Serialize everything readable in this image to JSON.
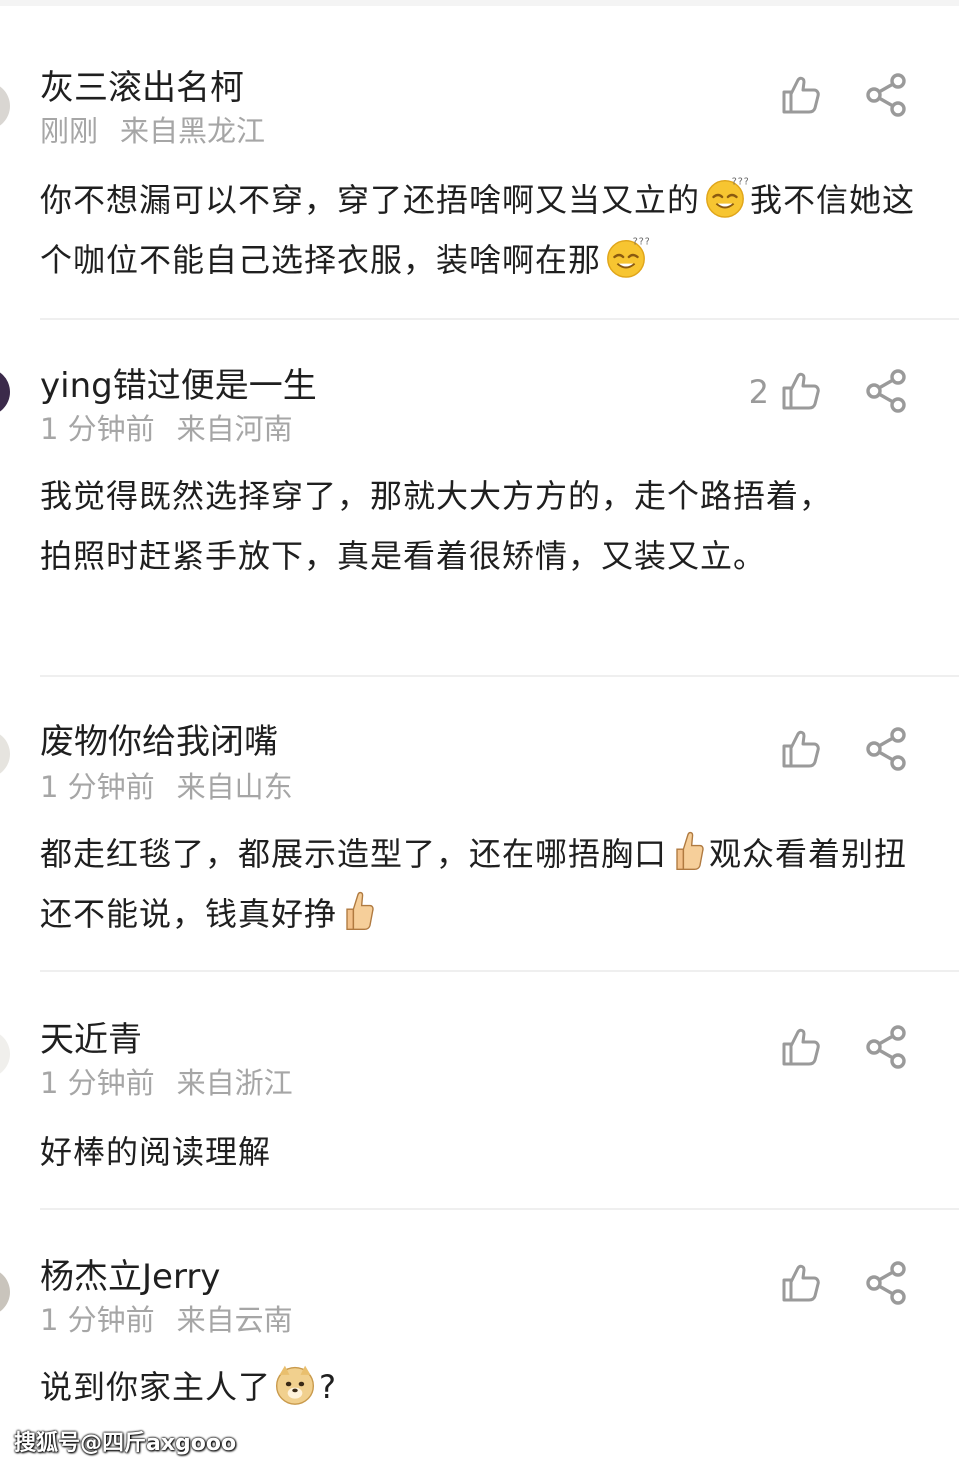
{
  "comments": [
    {
      "username": "灰三滚出名柯",
      "time": "刚刚",
      "location": "来自黑龙江",
      "likes": "",
      "text_parts": [
        "你不想漏可以不穿，穿了还捂啥啊又当又立的",
        "我不信她这个咖位不能自己选择衣服，装啥啊在那"
      ],
      "emoji": "sleepy-smile-emoji"
    },
    {
      "username": "ying错过便是一生",
      "time": "1 分钟前",
      "location": "来自河南",
      "likes": "2",
      "text": "我觉得既然选择穿了，那就大大方方的，走个路捂着，拍照时赶紧手放下，真是看着很矫情，又装又立。"
    },
    {
      "username": "废物你给我闭嘴",
      "time": "1 分钟前",
      "location": "来自山东",
      "likes": "",
      "text_parts": [
        "都走红毯了，都展示造型了，还在哪捂胸口",
        "观众看着别扭还不能说，钱真好挣"
      ],
      "emoji": "thumbs-up-emoji"
    },
    {
      "username": "天近青",
      "time": "1 分钟前",
      "location": "来自浙江",
      "likes": "",
      "text": "好棒的阅读理解"
    },
    {
      "username": "杨杰立Jerry",
      "time": "1 分钟前",
      "location": "来自云南",
      "likes": "",
      "text_parts": [
        "说到你家主人了",
        "?"
      ],
      "emoji": "doge-emoji"
    }
  ],
  "icons": {
    "like": "thumbs-up-outline-icon",
    "share": "share-icon"
  },
  "colors": {
    "username": "#1f1f1f",
    "meta": "#a6a6a6",
    "icon": "#9a9a9a",
    "divider": "#efefef"
  },
  "watermark": "搜狐号@四斤axgooo"
}
